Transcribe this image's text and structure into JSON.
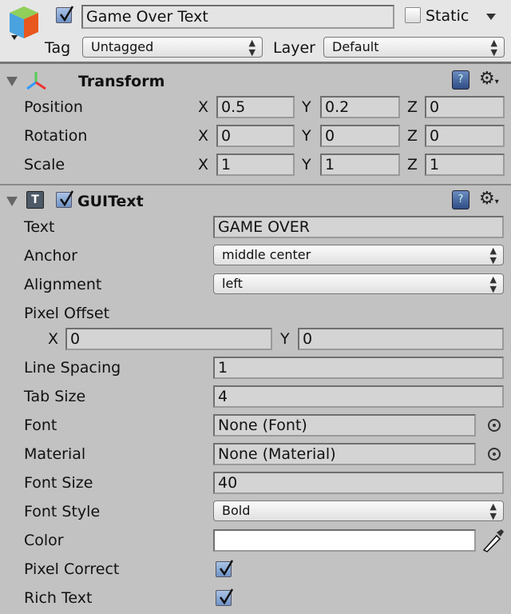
{
  "header": {
    "name": "Game Over Text",
    "active": true,
    "static_label": "Static",
    "static": false,
    "tag_label": "Tag",
    "tag": "Untagged",
    "layer_label": "Layer",
    "layer": "Default"
  },
  "transform": {
    "title": "Transform",
    "rows": [
      {
        "label": "Position",
        "x": "0.5",
        "y": "0.2",
        "z": "0"
      },
      {
        "label": "Rotation",
        "x": "0",
        "y": "0",
        "z": "0"
      },
      {
        "label": "Scale",
        "x": "1",
        "y": "1",
        "z": "1"
      }
    ],
    "axis": {
      "x": "X",
      "y": "Y",
      "z": "Z"
    }
  },
  "guitext": {
    "title": "GUIText",
    "enabled": true,
    "text_label": "Text",
    "text": "GAME OVER",
    "anchor_label": "Anchor",
    "anchor": "middle center",
    "alignment_label": "Alignment",
    "alignment": "left",
    "pixel_offset_label": "Pixel Offset",
    "offset_x": "0",
    "offset_y": "0",
    "line_spacing_label": "Line Spacing",
    "line_spacing": "1",
    "tab_size_label": "Tab Size",
    "tab_size": "4",
    "font_label": "Font",
    "font": "None (Font)",
    "material_label": "Material",
    "material": "None (Material)",
    "font_size_label": "Font Size",
    "font_size": "40",
    "font_style_label": "Font Style",
    "font_style": "Bold",
    "color_label": "Color",
    "color": "#ffffff",
    "pixel_correct_label": "Pixel Correct",
    "pixel_correct": true,
    "rich_text_label": "Rich Text",
    "rich_text": true
  },
  "icons": {
    "object": "gameobject-cube-icon",
    "transform": "transform-axes-icon",
    "help": "help-book-icon",
    "settings": "gear-icon",
    "picker": "object-picker-icon",
    "eyedropper": "eyedropper-icon"
  }
}
